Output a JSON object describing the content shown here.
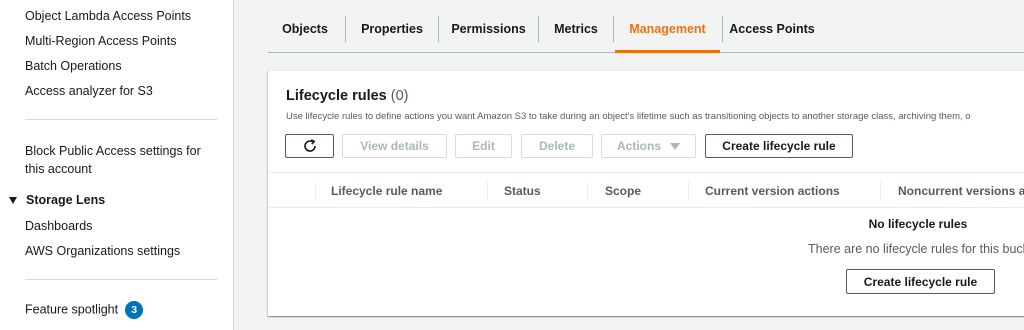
{
  "sidebar": {
    "links_top": [
      "Object Lambda Access Points",
      "Multi-Region Access Points",
      "Batch Operations",
      "Access analyzer for S3"
    ],
    "block_public_access": [
      "Block Public Access settings for",
      "this account"
    ],
    "storage_lens": {
      "label": "Storage Lens",
      "items": [
        "Dashboards",
        "AWS Organizations settings"
      ]
    },
    "feature_spotlight": {
      "label": "Feature spotlight",
      "badge": "3"
    }
  },
  "tabs": [
    {
      "label": "Objects",
      "active": false
    },
    {
      "label": "Properties",
      "active": false
    },
    {
      "label": "Permissions",
      "active": false
    },
    {
      "label": "Metrics",
      "active": false
    },
    {
      "label": "Management",
      "active": true
    },
    {
      "label": "Access Points",
      "active": false
    }
  ],
  "lifecycle": {
    "title": "Lifecycle rules",
    "count": "(0)",
    "description": "Use lifecycle rules to define actions you want Amazon S3 to take during an object's lifetime such as transitioning objects to another storage class, archiving them, o",
    "buttons": {
      "refresh_icon": "refresh-icon",
      "view_details": "View details",
      "edit": "Edit",
      "delete": "Delete",
      "actions": "Actions",
      "create": "Create lifecycle rule"
    },
    "columns": [
      "Lifecycle rule name",
      "Status",
      "Scope",
      "Current version actions",
      "Noncurrent versions ac"
    ],
    "empty_title": "No lifecycle rules",
    "empty_desc": "There are no lifecycle rules for this bucke",
    "empty_button": "Create lifecycle rule"
  },
  "colors": {
    "accent": "#ec7211",
    "badge": "#0073bb",
    "text": "#16191f",
    "muted": "#545b64"
  }
}
